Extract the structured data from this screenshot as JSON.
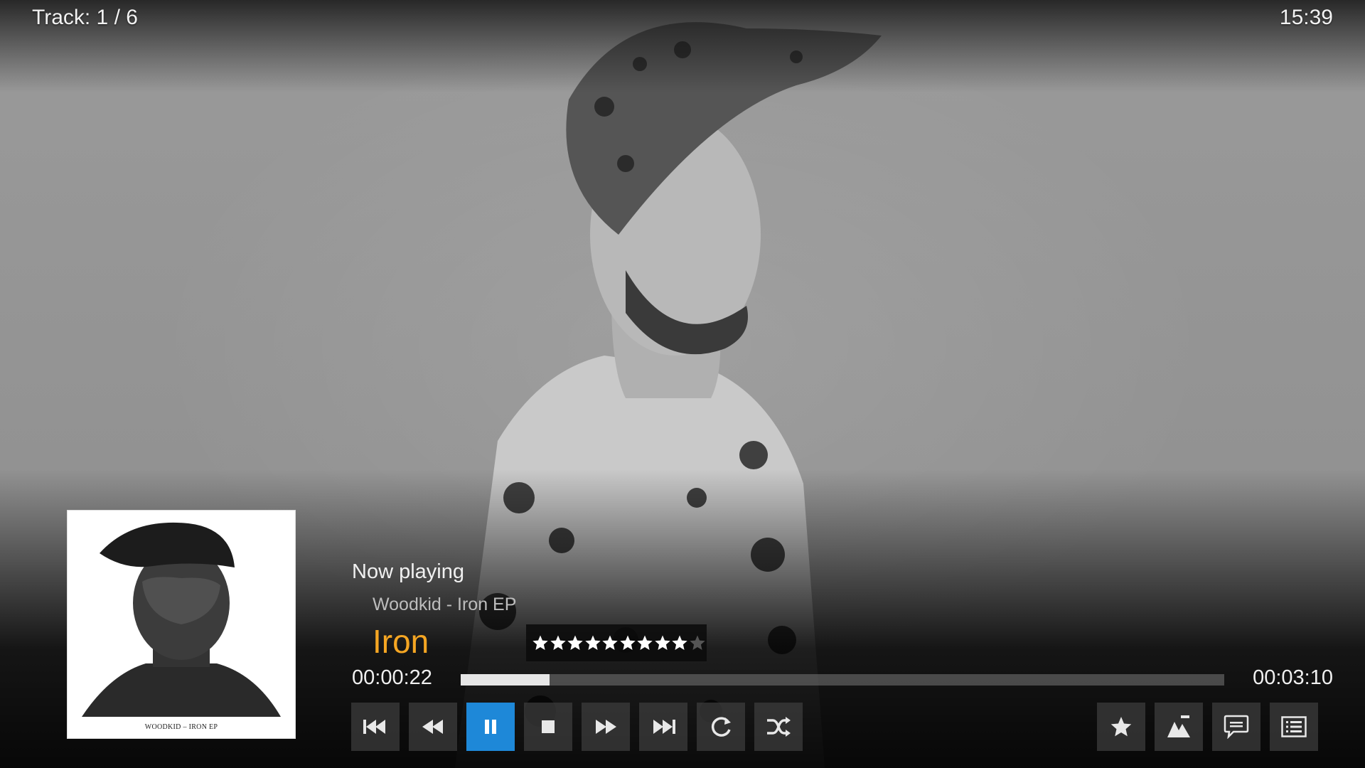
{
  "header": {
    "track_info": "Track: 1 / 6",
    "clock": "15:39"
  },
  "album_cover": {
    "caption": "WOODKID – IRON EP"
  },
  "now_playing": {
    "label": "Now playing",
    "artist_album": "Woodkid - Iron EP",
    "title": "Iron"
  },
  "rating": {
    "filled": 9,
    "max": 10
  },
  "progress": {
    "elapsed": "00:00:22",
    "duration": "00:03:10",
    "fraction": 0.116
  },
  "controls": {
    "left": [
      "previous-icon",
      "rewind-icon",
      "pause-icon",
      "stop-icon",
      "fast-forward-icon",
      "next-icon",
      "repeat-icon",
      "shuffle-icon"
    ],
    "active": "pause-icon",
    "right": [
      "star-icon",
      "visualization-icon",
      "lyrics-icon",
      "playlist-icon"
    ]
  },
  "colors": {
    "accent_title": "#f5a623",
    "active_button": "#1e88d8"
  }
}
